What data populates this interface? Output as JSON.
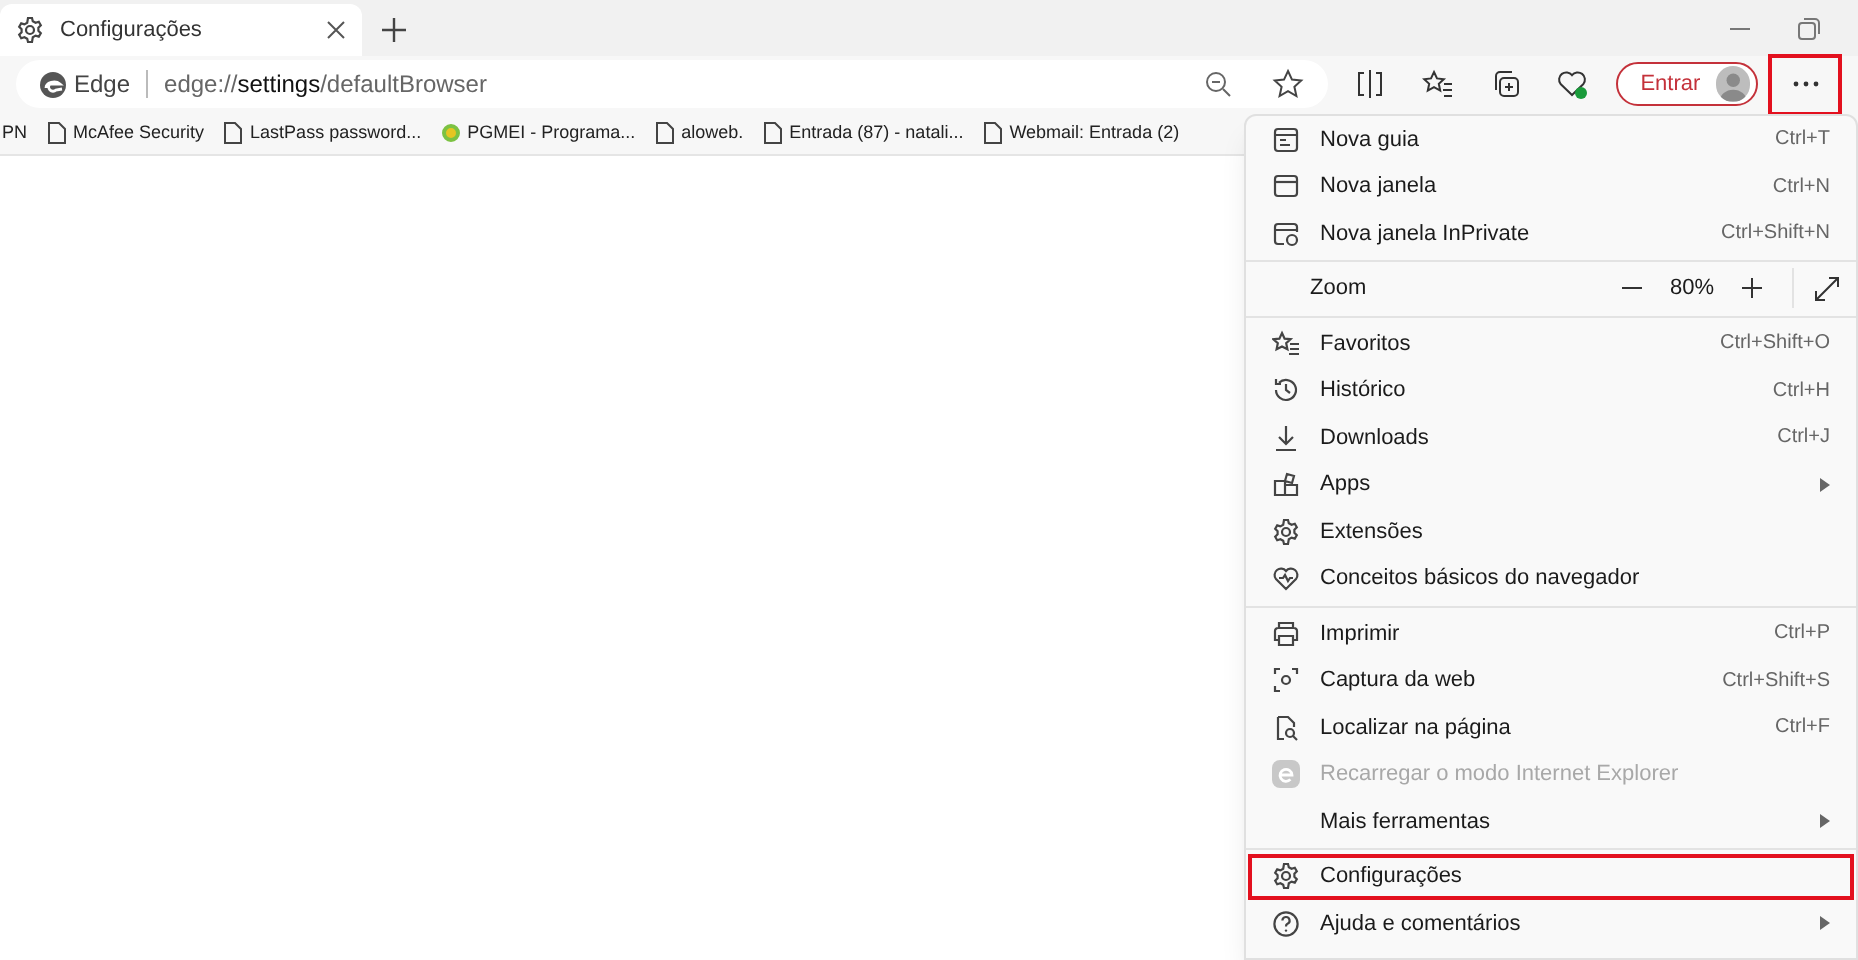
{
  "tab": {
    "title": "Configurações",
    "selected": true
  },
  "address": {
    "site_label": "Edge",
    "url_pre": "edge://",
    "url_bold": "settings",
    "url_post": "/defaultBrowser"
  },
  "sign_in": "Entrar",
  "more_button": {
    "highlighted": true
  },
  "bookmarks": [
    {
      "label": "PN",
      "kind": "cut"
    },
    {
      "label": "McAfee Security",
      "kind": "page"
    },
    {
      "label": "LastPass password...",
      "kind": "page"
    },
    {
      "label": "PGMEI - Programa...",
      "kind": "site"
    },
    {
      "label": "aloweb.",
      "kind": "page"
    },
    {
      "label": "Entrada (87) - natali...",
      "kind": "page"
    },
    {
      "label": "Webmail: Entrada (2)",
      "kind": "page"
    }
  ],
  "menu": {
    "sections": [
      [
        {
          "kind": "item",
          "label": "Nova guia",
          "shortcut": "Ctrl+T",
          "disabled": false,
          "submenu": false,
          "highlighted": false
        },
        {
          "kind": "item",
          "label": "Nova janela",
          "shortcut": "Ctrl+N",
          "disabled": false,
          "submenu": false,
          "highlighted": false
        },
        {
          "kind": "item",
          "label": "Nova janela InPrivate",
          "shortcut": "Ctrl+Shift+N",
          "disabled": false,
          "submenu": false,
          "highlighted": false
        }
      ],
      [
        {
          "kind": "zoom",
          "label": "Zoom",
          "value": "80%"
        }
      ],
      [
        {
          "kind": "item",
          "label": "Favoritos",
          "shortcut": "Ctrl+Shift+O",
          "disabled": false,
          "submenu": false,
          "highlighted": false
        },
        {
          "kind": "item",
          "label": "Histórico",
          "shortcut": "Ctrl+H",
          "disabled": false,
          "submenu": false,
          "highlighted": false
        },
        {
          "kind": "item",
          "label": "Downloads",
          "shortcut": "Ctrl+J",
          "disabled": false,
          "submenu": false,
          "highlighted": false
        },
        {
          "kind": "item",
          "label": "Apps",
          "disabled": false,
          "submenu": true,
          "highlighted": false
        },
        {
          "kind": "item",
          "label": "Extensões",
          "disabled": false,
          "submenu": false,
          "highlighted": false
        },
        {
          "kind": "item",
          "label": "Conceitos básicos do navegador",
          "disabled": false,
          "submenu": false,
          "highlighted": false
        }
      ],
      [
        {
          "kind": "item",
          "label": "Imprimir",
          "shortcut": "Ctrl+P",
          "disabled": false,
          "submenu": false,
          "highlighted": false
        },
        {
          "kind": "item",
          "label": "Captura da web",
          "shortcut": "Ctrl+Shift+S",
          "disabled": false,
          "submenu": false,
          "highlighted": false
        },
        {
          "kind": "item",
          "label": "Localizar na página",
          "shortcut": "Ctrl+F",
          "disabled": false,
          "submenu": false,
          "highlighted": false
        },
        {
          "kind": "item",
          "label": "Recarregar o modo Internet Explorer",
          "disabled": true,
          "submenu": false,
          "highlighted": false
        },
        {
          "kind": "item",
          "label": "Mais ferramentas",
          "disabled": false,
          "submenu": true,
          "highlighted": false
        }
      ],
      [
        {
          "kind": "item",
          "label": "Configurações",
          "disabled": false,
          "submenu": false,
          "highlighted": true
        },
        {
          "kind": "item",
          "label": "Ajuda e comentários",
          "disabled": false,
          "submenu": true,
          "highlighted": false
        }
      ]
    ]
  }
}
